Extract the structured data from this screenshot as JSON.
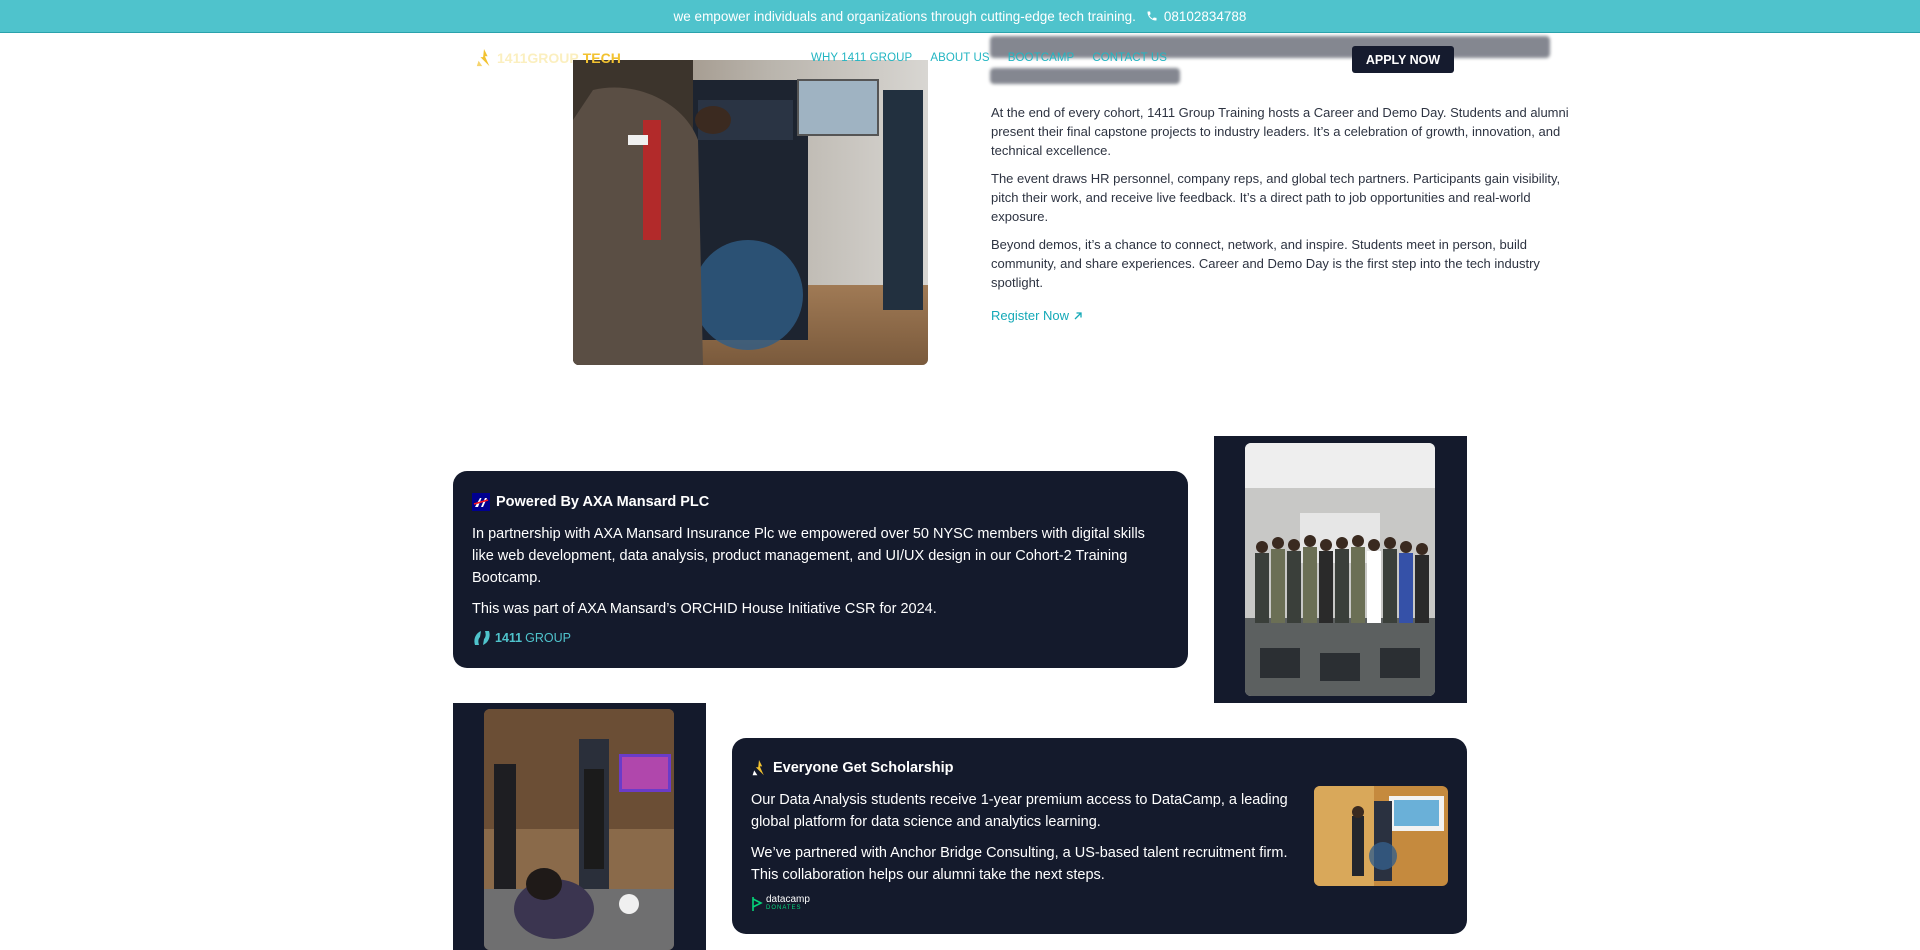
{
  "announcement": {
    "text": "we empower individuals and organizations through cutting-edge tech training.",
    "phone": "08102834788"
  },
  "header": {
    "logo_word1": "1411GROUP",
    "logo_word2": "TECH",
    "nav": [
      "WHY 1411 GROUP",
      "ABOUT US",
      "BOOTCAMP",
      "CONTACT US"
    ],
    "apply_label": "APPLY NOW"
  },
  "career_day": {
    "paragraphs": [
      "At the end of every cohort, 1411 Group Training hosts a Career and Demo Day. Students and alumni present their final capstone projects to industry leaders. It’s a celebration of growth, innovation, and technical excellence.",
      "The event draws HR personnel, company reps, and global tech partners. Participants gain visibility, pitch their work, and receive live feedback. It’s a direct path to job opportunities and real-world exposure.",
      "Beyond demos, it’s a chance to connect, network, and inspire. Students meet in person, build community, and share experiences. Career and Demo Day is the first step into the tech industry spotlight."
    ],
    "register_label": "Register Now"
  },
  "axa_card": {
    "title": "Powered By AXA Mansard PLC",
    "paragraphs": [
      "In partnership with AXA Mansard Insurance Plc we empowered over 50 NYSC members with digital skills like web development, data analysis, product management, and UI/UX design in our Cohort-2 Training Bootcamp.",
      "This was part of AXA Mansard’s ORCHID House Initiative CSR for 2024."
    ],
    "logo_bold": "1411",
    "logo_light": "GROUP"
  },
  "scholarship_card": {
    "title": "Everyone Get Scholarship",
    "paragraphs": [
      "Our Data Analysis students receive 1-year premium access to DataCamp, a leading global platform for data science and analytics learning.",
      "We’ve partnered with Anchor Bridge Consulting, a US-based talent recruitment firm. This collaboration helps our alumni take the next steps."
    ],
    "logo_text": "datacamp",
    "logo_sub": "DONATES"
  },
  "colors": {
    "topbar": "#4fc3cc",
    "card_bg": "#141a2c",
    "accent": "#14a9b7",
    "logo_yellow": "#f2c230"
  }
}
